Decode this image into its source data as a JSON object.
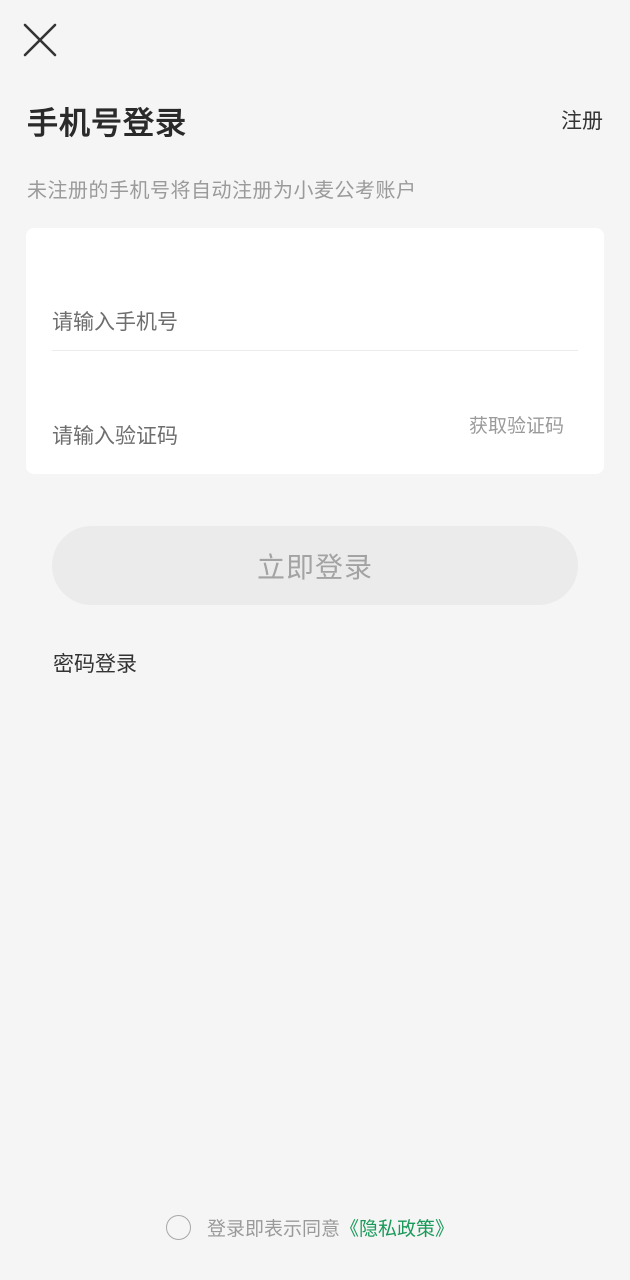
{
  "header": {
    "close_icon": "close-icon",
    "title": "手机号登录",
    "register_label": "注册",
    "subtitle": "未注册的手机号将自动注册为小麦公考账户"
  },
  "form": {
    "phone_placeholder": "请输入手机号",
    "code_placeholder": "请输入验证码",
    "get_code_label": "获取验证码"
  },
  "actions": {
    "login_label": "立即登录",
    "password_login_label": "密码登录"
  },
  "agreement": {
    "prefix": "登录即表示同意",
    "policy_label": "《隐私政策》",
    "checked": false
  },
  "colors": {
    "background": "#f5f5f5",
    "card": "#ffffff",
    "accent_link": "#1a9a5a",
    "button_disabled_bg": "#ebebeb"
  }
}
